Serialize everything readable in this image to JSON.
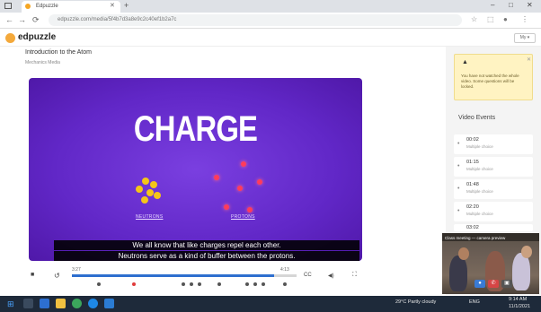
{
  "browser": {
    "tab_title": "Edpuzzle",
    "new_tab": "+",
    "window_controls": [
      "–",
      "□",
      "✕"
    ],
    "url": "edpuzzle.com/media/5f4b7d3a8e9c2c40ef1b2a7c",
    "nav": [
      "←",
      "→",
      "⟳"
    ],
    "toolbar_icons": [
      "star-icon",
      "extensions-icon",
      "profile-icon",
      "menu-icon"
    ]
  },
  "header": {
    "brand": "edpuzzle",
    "right_button": "My ▾"
  },
  "page": {
    "title": "Introduction to the Atom",
    "subtitle": "Mechanics Media"
  },
  "video": {
    "heading": "CHARGE",
    "label_left": "NEUTRONS",
    "label_right": "PROTONS",
    "caption_line1": "We all know that like charges repel each other.",
    "caption_line2": "Neutrons serve as a kind of buffer between the protons."
  },
  "player": {
    "time_current": "3:27",
    "time_total": "4:13",
    "progress": 0.9,
    "play_icon": "stop-icon",
    "rewind_label": "↺",
    "cc_label": "CC",
    "volume_label": "◀)",
    "fullscreen_label": "⛶"
  },
  "sidebar": {
    "warning_icon": "▲",
    "warning_text": "You have not watched the whole video. Some questions will be locked.",
    "warning_close": "✕",
    "events_title": "Video Events",
    "events": [
      {
        "time": "00:02",
        "type": "Multiple choice"
      },
      {
        "time": "01:15",
        "type": "Multiple choice"
      },
      {
        "time": "01:48",
        "type": "Multiple choice"
      },
      {
        "time": "02:20",
        "type": "Multiple choice"
      },
      {
        "time": "03:02",
        "type": "Multiple choice"
      }
    ]
  },
  "webcam": {
    "title": "Class meeting — camera preview"
  },
  "taskbar": {
    "weather": "29°C Partly cloudy",
    "lang": "ENG",
    "time": "9:14 AM",
    "date": "11/1/2021"
  }
}
